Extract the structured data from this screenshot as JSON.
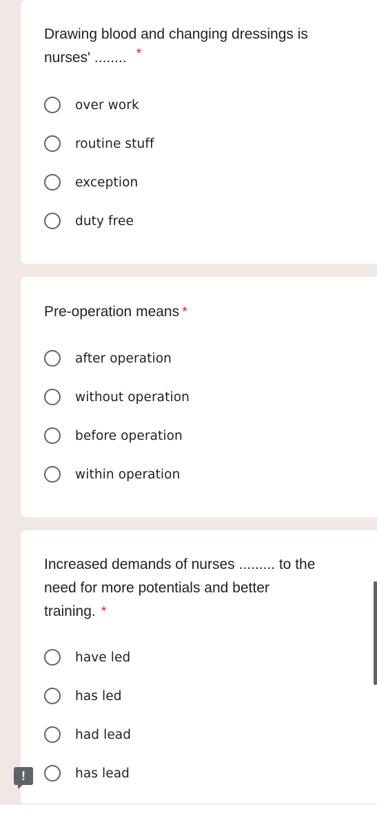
{
  "questions": [
    {
      "title_line1": "Drawing blood and changing dressings is",
      "title_line2": "nurses' ........",
      "required_mark": "*",
      "options": [
        "over work",
        "routine stuff",
        "exception",
        "duty free"
      ]
    },
    {
      "title_line1": "Pre-operation means",
      "required_mark": "*",
      "options": [
        "after operation",
        "without operation",
        "before operation",
        "within operation"
      ]
    },
    {
      "title_line1": "Increased demands of nurses ......... to the",
      "title_line2": "need for more potentials and better",
      "title_line3": "training.",
      "required_mark": "*",
      "options": [
        "have led",
        "has led",
        "had lead",
        "has lead"
      ]
    }
  ],
  "report_button": {
    "icon": "report-icon",
    "glyph": "!"
  },
  "colors": {
    "background": "#f1e8e6",
    "card": "#ffffff",
    "required": "#d93025",
    "radio_border": "#5f6368"
  }
}
